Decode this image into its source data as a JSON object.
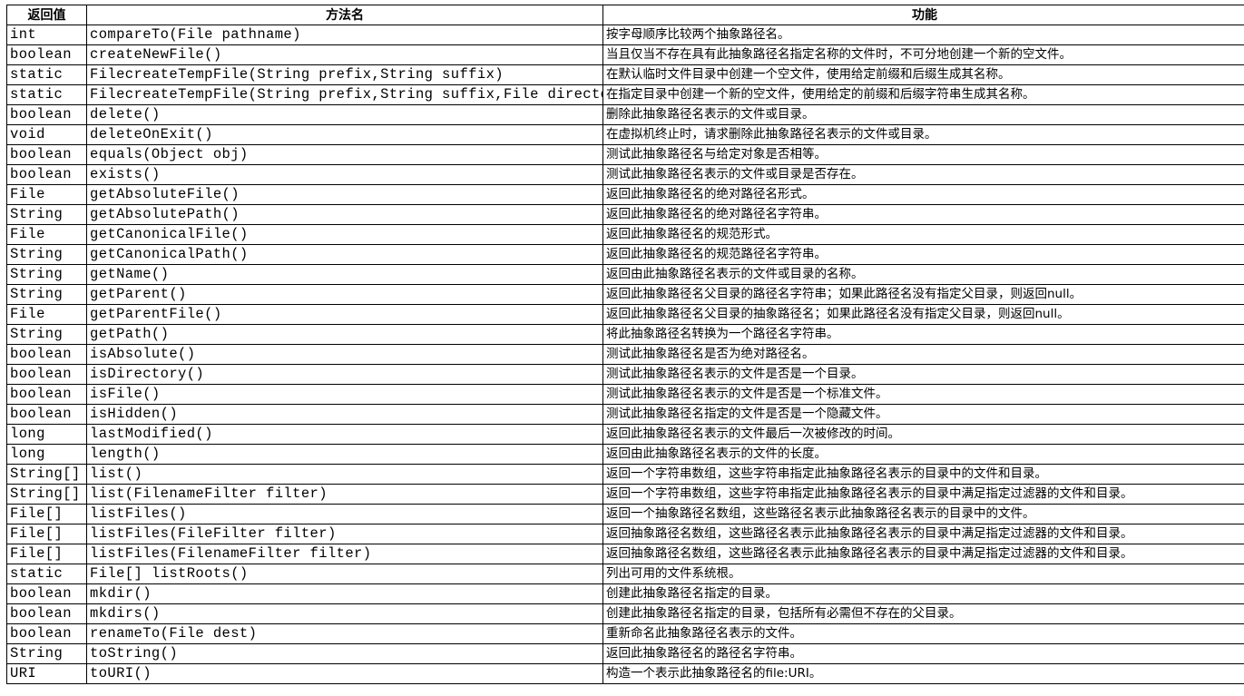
{
  "headers": [
    "返回值",
    "方法名",
    "功能"
  ],
  "rows": [
    {
      "ret": "int",
      "method": "compareTo(File pathname)",
      "desc": "按字母顺序比较两个抽象路径名。"
    },
    {
      "ret": "boolean",
      "method": "createNewFile()",
      "desc": "当且仅当不存在具有此抽象路径名指定名称的文件时，不可分地创建一个新的空文件。"
    },
    {
      "ret": "static",
      "method": "FilecreateTempFile(String prefix,String suffix)",
      "desc": "在默认临时文件目录中创建一个空文件，使用给定前缀和后缀生成其名称。"
    },
    {
      "ret": "static",
      "method": "FilecreateTempFile(String prefix,String suffix,File directory)",
      "desc": "在指定目录中创建一个新的空文件，使用给定的前缀和后缀字符串生成其名称。"
    },
    {
      "ret": "boolean",
      "method": "delete()",
      "desc": "删除此抽象路径名表示的文件或目录。"
    },
    {
      "ret": "void",
      "method": "deleteOnExit()",
      "desc": "在虚拟机终止时，请求删除此抽象路径名表示的文件或目录。"
    },
    {
      "ret": "boolean",
      "method": "equals(Object obj)",
      "desc": "测试此抽象路径名与给定对象是否相等。"
    },
    {
      "ret": "boolean",
      "method": "exists()",
      "desc": "测试此抽象路径名表示的文件或目录是否存在。"
    },
    {
      "ret": "File",
      "method": "getAbsoluteFile()",
      "desc": "返回此抽象路径名的绝对路径名形式。"
    },
    {
      "ret": "String",
      "method": "getAbsolutePath()",
      "desc": "返回此抽象路径名的绝对路径名字符串。"
    },
    {
      "ret": "File",
      "method": "getCanonicalFile()",
      "desc": "返回此抽象路径名的规范形式。"
    },
    {
      "ret": "String",
      "method": "getCanonicalPath()",
      "desc": "返回此抽象路径名的规范路径名字符串。"
    },
    {
      "ret": "String",
      "method": "getName()",
      "desc": "返回由此抽象路径名表示的文件或目录的名称。"
    },
    {
      "ret": "String",
      "method": "getParent()",
      "desc": "返回此抽象路径名父目录的路径名字符串；如果此路径名没有指定父目录，则返回null。"
    },
    {
      "ret": "File",
      "method": "getParentFile()",
      "desc": "返回此抽象路径名父目录的抽象路径名；如果此路径名没有指定父目录，则返回null。"
    },
    {
      "ret": "String",
      "method": "getPath()",
      "desc": "将此抽象路径名转换为一个路径名字符串。"
    },
    {
      "ret": "boolean",
      "method": "isAbsolute()",
      "desc": "测试此抽象路径名是否为绝对路径名。"
    },
    {
      "ret": "boolean",
      "method": "isDirectory()",
      "desc": "测试此抽象路径名表示的文件是否是一个目录。"
    },
    {
      "ret": "boolean",
      "method": "isFile()",
      "desc": "测试此抽象路径名表示的文件是否是一个标准文件。"
    },
    {
      "ret": "boolean",
      "method": "isHidden()",
      "desc": "测试此抽象路径名指定的文件是否是一个隐藏文件。"
    },
    {
      "ret": "long",
      "method": "lastModified()",
      "desc": "返回此抽象路径名表示的文件最后一次被修改的时间。"
    },
    {
      "ret": "long",
      "method": "length()",
      "desc": "返回由此抽象路径名表示的文件的长度。"
    },
    {
      "ret": "String[]",
      "method": "list()",
      "desc": "返回一个字符串数组，这些字符串指定此抽象路径名表示的目录中的文件和目录。"
    },
    {
      "ret": "String[]",
      "method": "list(FilenameFilter filter)",
      "desc": "返回一个字符串数组，这些字符串指定此抽象路径名表示的目录中满足指定过滤器的文件和目录。"
    },
    {
      "ret": "File[]",
      "method": "listFiles()",
      "desc": "返回一个抽象路径名数组，这些路径名表示此抽象路径名表示的目录中的文件。"
    },
    {
      "ret": "File[]",
      "method": "listFiles(FileFilter filter)",
      "desc": "返回抽象路径名数组，这些路径名表示此抽象路径名表示的目录中满足指定过滤器的文件和目录。"
    },
    {
      "ret": "File[]",
      "method": "listFiles(FilenameFilter filter)",
      "desc": "返回抽象路径名数组，这些路径名表示此抽象路径名表示的目录中满足指定过滤器的文件和目录。"
    },
    {
      "ret": "static",
      "method": "File[] listRoots()",
      "desc": "列出可用的文件系统根。"
    },
    {
      "ret": "boolean",
      "method": "mkdir()",
      "desc": "创建此抽象路径名指定的目录。"
    },
    {
      "ret": "boolean",
      "method": "mkdirs()",
      "desc": "创建此抽象路径名指定的目录，包括所有必需但不存在的父目录。"
    },
    {
      "ret": "boolean",
      "method": "renameTo(File dest)",
      "desc": "重新命名此抽象路径名表示的文件。"
    },
    {
      "ret": "String",
      "method": "toString()",
      "desc": "返回此抽象路径名的路径名字符串。"
    },
    {
      "ret": "URI",
      "method": "toURI()",
      "desc": "构造一个表示此抽象路径名的file:URI。"
    }
  ]
}
